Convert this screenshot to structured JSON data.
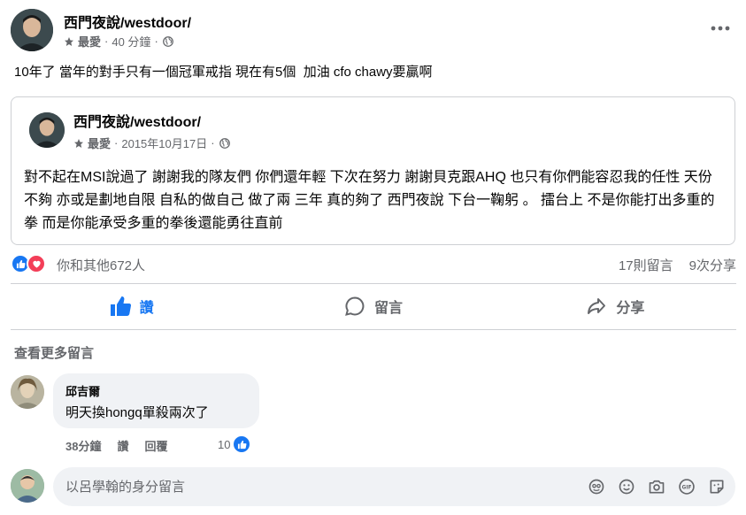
{
  "post": {
    "author": "西門夜說/westdoor/",
    "meta_label": "最愛",
    "time": "40 分鐘",
    "text": "10年了 當年的對手只有一個冠軍戒指 現在有5個  加油 cfo chawy要贏啊"
  },
  "shared_post": {
    "author": "西門夜說/westdoor/",
    "meta_label": "最愛",
    "date": "2015年10月17日",
    "text": "對不起在MSI說過了 謝謝我的隊友們 你們還年輕 下次在努力 謝謝貝克跟AHQ 也只有你們能容忍我的任性 天份不夠 亦或是劃地自限 自私的做自己 做了兩 三年 真的夠了 西門夜說 下台一鞠躬 。 擂台上 不是你能打出多重的拳 而是你能承受多重的拳後還能勇往直前"
  },
  "reactions": {
    "count_text": "你和其他672人",
    "comments_text": "17則留言",
    "shares_text": "9次分享"
  },
  "actions": {
    "like": "讚",
    "comment": "留言",
    "share": "分享"
  },
  "comments": {
    "more_label": "查看更多留言",
    "items": [
      {
        "author": "邱吉爾",
        "text": "明天換hongq單殺兩次了",
        "time": "38分鐘",
        "like": "讚",
        "reply": "回覆",
        "likes": "10"
      }
    ]
  },
  "composer": {
    "placeholder": "以呂學翰的身分留言"
  },
  "colors": {
    "accent": "#1877f2",
    "love": "#f33e58",
    "secondary_text": "#65676b",
    "bubble_bg": "#f0f2f5"
  }
}
